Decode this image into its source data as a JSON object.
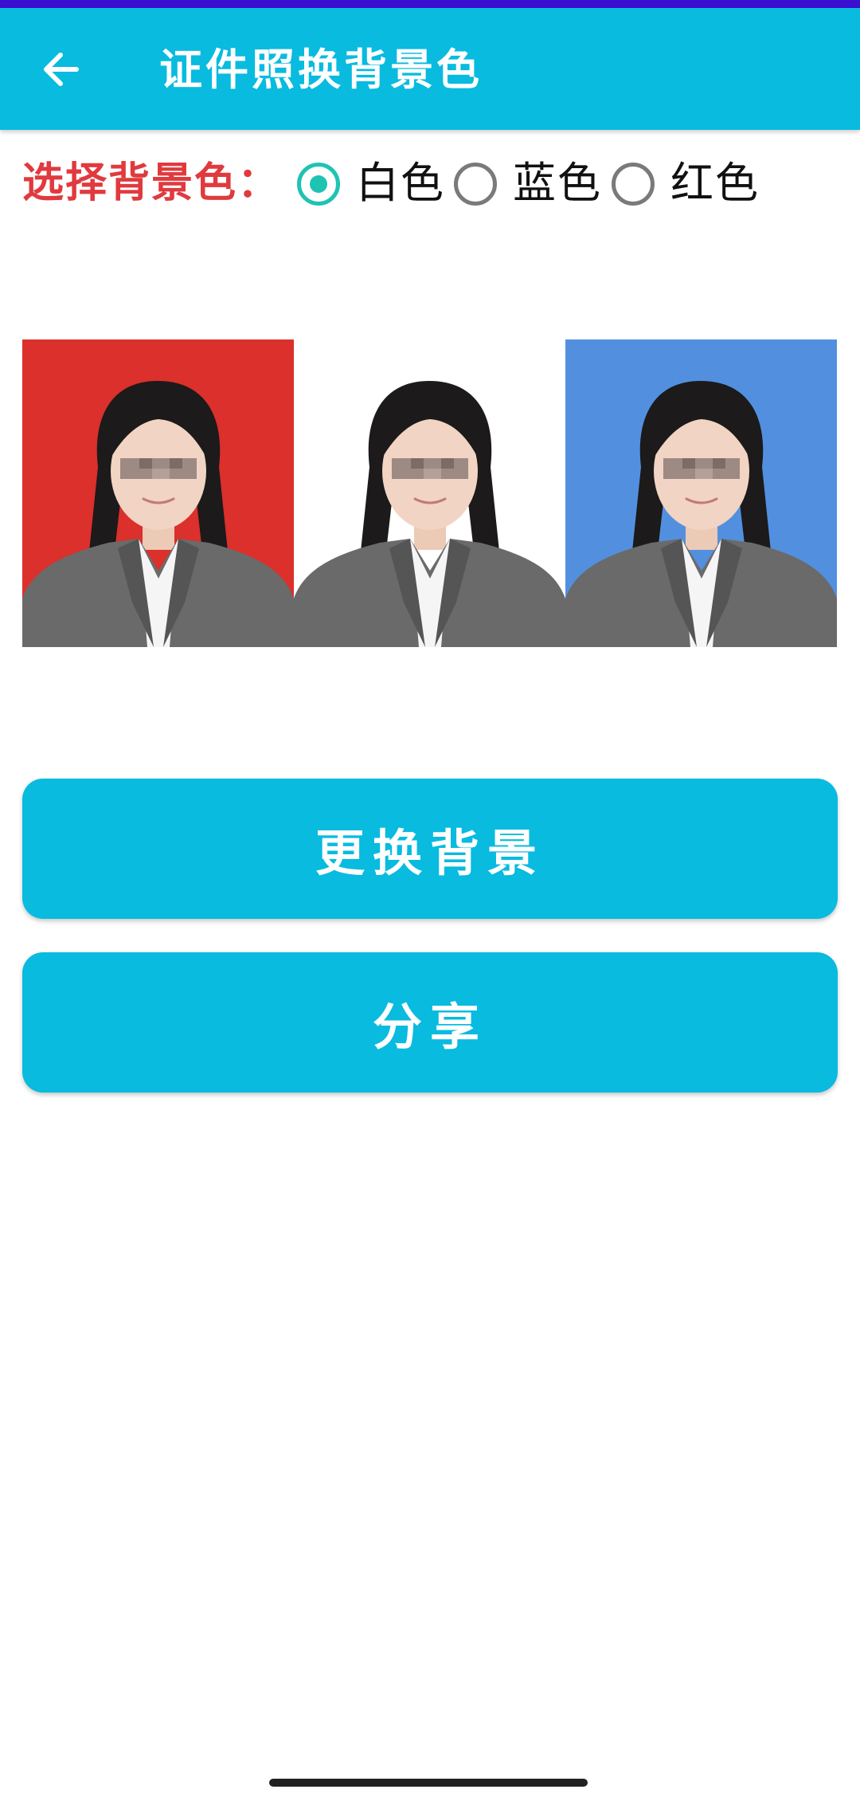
{
  "toolbar": {
    "title": "证件照换背景色",
    "back_icon": "arrow-left-icon"
  },
  "background_select": {
    "label": "选择背景色：",
    "options": [
      {
        "label": "白色",
        "checked": true
      },
      {
        "label": "蓝色",
        "checked": false
      },
      {
        "label": "红色",
        "checked": false
      }
    ]
  },
  "photos": [
    {
      "name": "red-background",
      "bg_color": "#db302b"
    },
    {
      "name": "white-background",
      "bg_color": "#ffffff"
    },
    {
      "name": "blue-background",
      "bg_color": "#5290df"
    }
  ],
  "actions": {
    "change_label": "更换背景",
    "share_label": "分享"
  },
  "colors": {
    "primary": "#08bbdf",
    "status_bar": "#3a0fcf",
    "label_red": "#e03a3e",
    "radio_checked": "#1fc3b2"
  }
}
